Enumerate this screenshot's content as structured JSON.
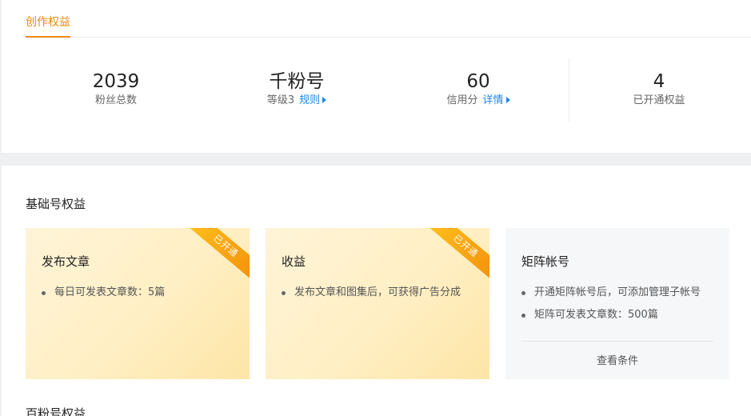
{
  "tab": {
    "label": "创作权益"
  },
  "stats": [
    {
      "value": "2039",
      "label": "粉丝总数",
      "link": ""
    },
    {
      "value": "千粉号",
      "label": "等级3",
      "link": "规则"
    },
    {
      "value": "60",
      "label": "信用分",
      "link": "详情"
    },
    {
      "value": "4",
      "label": "已开通权益",
      "link": ""
    }
  ],
  "basic_section": {
    "title": "基础号权益",
    "cards": [
      {
        "title": "发布文章",
        "status": "open",
        "badge": "已开通",
        "bullets": [
          "每日可发表文章数：5篇"
        ]
      },
      {
        "title": "收益",
        "status": "open",
        "badge": "已开通",
        "bullets": [
          "发布文章和图集后，可获得广告分成"
        ]
      },
      {
        "title": "矩阵帐号",
        "status": "locked",
        "bullets": [
          "开通矩阵帐号后，可添加管理子帐号",
          "矩阵可发表文章数：500篇"
        ],
        "action": "查看条件"
      }
    ]
  },
  "next_section": {
    "title": "百粉号权益"
  },
  "colors": {
    "accent": "#f0870f",
    "link": "#1a86e8",
    "ribbon": "#f5a013"
  },
  "icons": [
    "triangle-right-icon"
  ]
}
